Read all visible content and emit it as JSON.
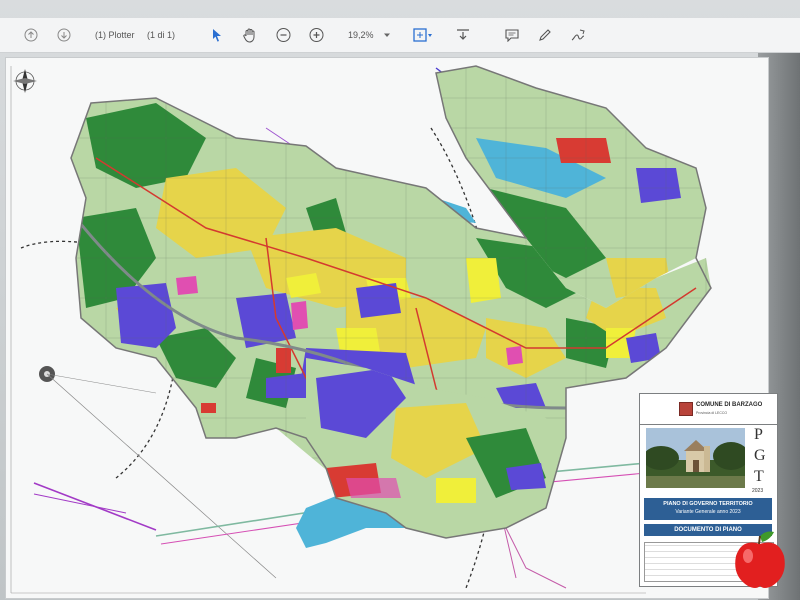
{
  "toolbar": {
    "page_label": "(1) Plotter",
    "page_count": "(1 di 1)",
    "zoom_value": "19,2%",
    "icons": [
      "page-up-icon",
      "page-down-icon",
      "select-arrow-icon",
      "hand-tool-icon",
      "zoom-out-icon",
      "zoom-in-icon",
      "fit-page-icon",
      "download-icon",
      "comment-icon",
      "pen-icon",
      "sign-icon"
    ]
  },
  "title_block": {
    "comune": "COMUNE DI BARZAGO",
    "provincia": "Provincia di LECCO",
    "logo_letters": [
      "P",
      "G",
      "T"
    ],
    "year": "2023",
    "plan_line1": "PIANO DI GOVERNO  TERRITORIO",
    "plan_line2": "Variante Generale anno 2023",
    "doc_title": "DOCUMENTO DI PIANO"
  },
  "colors": {
    "forest": "#2f8a3a",
    "agriculture": "#b9d7a5",
    "residential": "#e6d44a",
    "commercial": "#f0ef3a",
    "industrial": "#5b49d6",
    "services": "#e04fb1",
    "water": "#4fb4d8",
    "roads": "#d43a2f",
    "title_band": "#2d5f95"
  }
}
